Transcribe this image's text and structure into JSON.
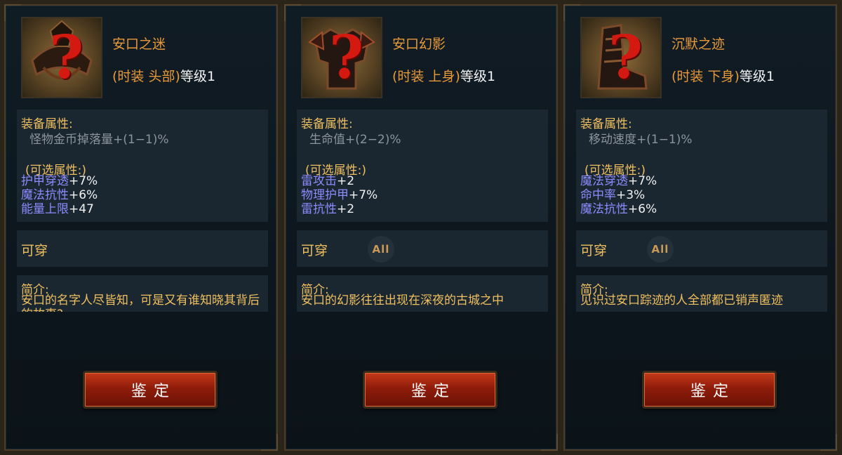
{
  "panels": [
    {
      "name": "安口之迷",
      "type_prefix": "(时装 头部)",
      "level": "等级1",
      "attr_title": "装备属性:",
      "base_attr": "怪物金币掉落量+(1−1)%",
      "optional_title": "(可选属性:)",
      "optional": [
        {
          "name": "护甲穿透",
          "value": "+7%"
        },
        {
          "name": "魔法抗性",
          "value": "+6%"
        },
        {
          "name": "能量上限",
          "value": "+47"
        }
      ],
      "wear_label": "可穿",
      "wear_badge": "",
      "desc_title": "简介:",
      "desc_text": "安口的名字人尽皆知，可是又有谁知晓其背后的故事?",
      "button": "鉴定",
      "icon": "helmet-icon"
    },
    {
      "name": "安口幻影",
      "type_prefix": "(时装 上身)",
      "level": "等级1",
      "attr_title": "装备属性:",
      "base_attr": "生命值+(2−2)%",
      "optional_title": "(可选属性:)",
      "optional": [
        {
          "name": "雷攻击",
          "value": "+2"
        },
        {
          "name": "物理护甲",
          "value": "+7%"
        },
        {
          "name": "雷抗性",
          "value": "+2"
        }
      ],
      "wear_label": "可穿",
      "wear_badge": "All",
      "desc_title": "简介:",
      "desc_text": "安口的幻影往往出现在深夜的古城之中",
      "button": "鉴定",
      "icon": "chest-armor-icon"
    },
    {
      "name": "沉默之迹",
      "type_prefix": "(时装 下身)",
      "level": "等级1",
      "attr_title": "装备属性:",
      "base_attr": "移动速度+(1−1)%",
      "optional_title": "(可选属性:)",
      "optional": [
        {
          "name": "魔法穿透",
          "value": "+7%"
        },
        {
          "name": "命中率",
          "value": "+3%"
        },
        {
          "name": "魔法抗性",
          "value": "+6%"
        }
      ],
      "wear_label": "可穿",
      "wear_badge": "All",
      "desc_title": "简介:",
      "desc_text": "见识过安口踪迹的人全部都已销声匿迹",
      "button": "鉴定",
      "icon": "boots-icon"
    }
  ],
  "colors": {
    "gold": "#f0c060",
    "orange": "#e89a3a",
    "attr_blue": "#8c8cff",
    "question_red": "#d41a10",
    "button_red": "#8f1c0a"
  }
}
